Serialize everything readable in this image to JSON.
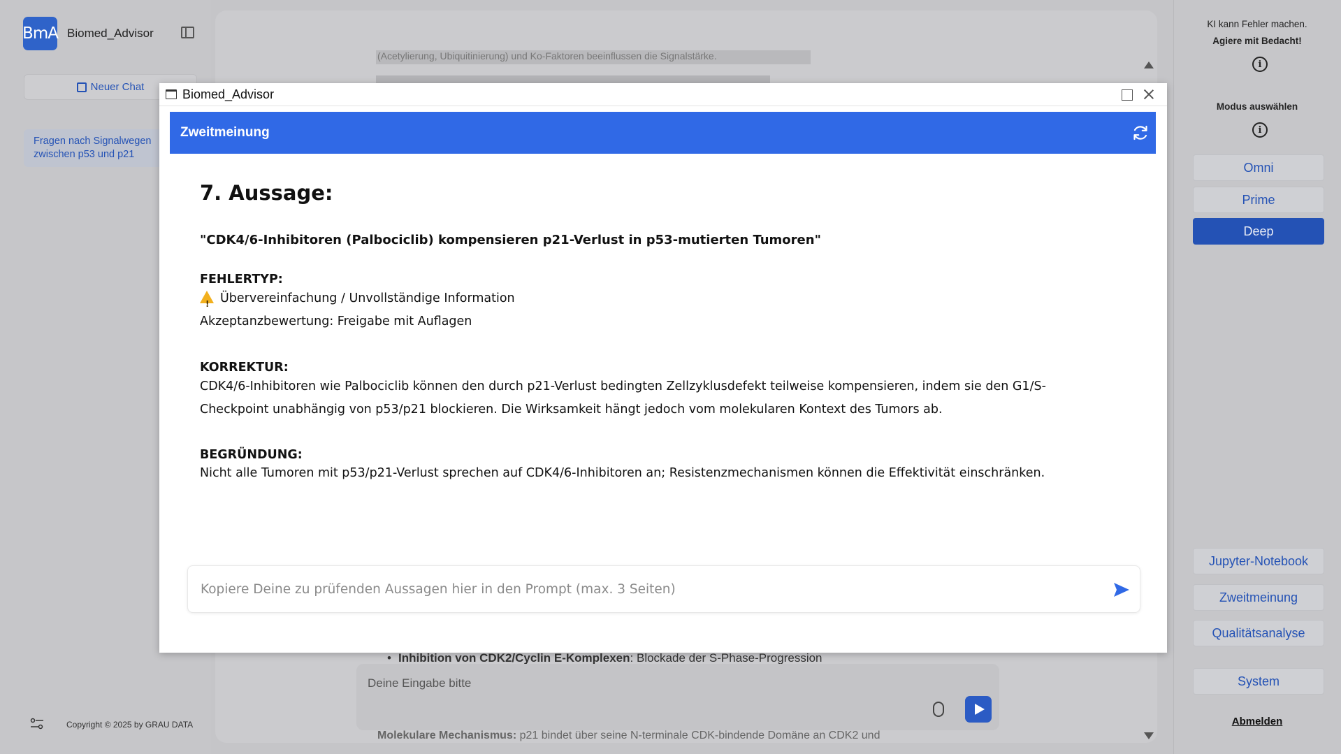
{
  "app": {
    "logo_text": "BmA",
    "name": "Biomed_Advisor",
    "new_chat_label": "Neuer Chat",
    "chat_history": [
      "Fragen nach Signalwegen zwischen p53 und p21"
    ],
    "copyright": "Copyright © 2025 by GRAU DATA"
  },
  "background": {
    "text_line": "(Acetylierung, Ubiquitinierung) und Ko-Faktoren beeinflussen die Signalstärke.",
    "bullet_bold": "Inhibition von CDK2/Cyclin E-Komplexen",
    "bullet_text": ": Blockade der S-Phase-Progression",
    "input_placeholder": "Deine Eingabe bitte",
    "tail_bold": "Molekulare Mechanismus:",
    "tail_text": " p21 bindet über seine N-terminale CDK-bindende Domäne an CDK2 und"
  },
  "right_panel": {
    "warning_line1": "KI kann Fehler machen.",
    "warning_line2": "Agiere mit Bedacht!",
    "mode_label": "Modus auswählen",
    "modes": [
      "Omni",
      "Prime",
      "Deep"
    ],
    "active_mode": "Deep",
    "tools": [
      "Jupyter-Notebook",
      "Zweitmeinung",
      "Qualitätsanalyse"
    ],
    "system_label": "System",
    "logout_label": "Abmelden"
  },
  "modal": {
    "window_title": "Biomed_Advisor",
    "header_title": "Zweitmeinung",
    "heading": "7. Aussage:",
    "quote": "\"CDK4/6-Inhibitoren (Palbociclib) kompensieren p21-Verlust in p53-mutierten Tumoren\"",
    "error_type_label": "FEHLERTYP:",
    "error_type_value": "Übervereinfachung / Unvollständige Information",
    "acceptance": "Akzeptanzbewertung: Freigabe mit Auflagen",
    "correction_label": "KORREKTUR:",
    "correction_line1": "CDK4/6-Inhibitoren wie Palbociclib können den durch p21-Verlust bedingten Zellzyklusdefekt teilweise kompensieren, indem sie den G1/S-",
    "correction_line2": "Checkpoint unabhängig von p53/p21 blockieren. Die Wirksamkeit hängt jedoch vom molekularen Kontext des Tumors ab.",
    "reason_label": "BEGRÜNDUNG:",
    "reason_text": "Nicht alle Tumoren mit p53/p21-Verlust sprechen auf CDK4/6-Inhibitoren an; Resistenzmechanismen können die Effektivität einschränken.",
    "prompt_placeholder": "Kopiere Deine zu prüfenden Aussagen hier in den Prompt (max. 3 Seiten)"
  },
  "colors": {
    "accent": "#3069e6",
    "active_mode": "#2452b5",
    "link_blue": "#2452b5",
    "warning": "#f2b01e"
  }
}
